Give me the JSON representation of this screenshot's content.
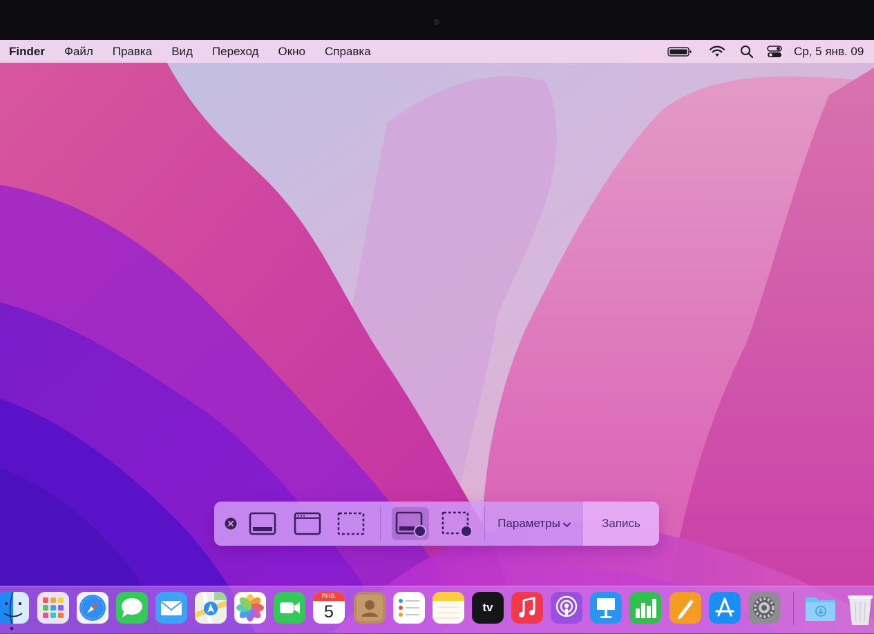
{
  "menubar": {
    "app_name": "Finder",
    "menus": [
      "Файл",
      "Правка",
      "Вид",
      "Переход",
      "Окно",
      "Справка"
    ],
    "status_icons": [
      "battery-icon",
      "wifi-icon",
      "search-icon",
      "control-center-icon"
    ],
    "clock": "Ср, 5 янв. 09"
  },
  "screenshot_toolbar": {
    "buttons": [
      {
        "name": "close",
        "icon": "close-icon"
      },
      {
        "name": "capture-entire-screen",
        "icon": "screen-icon"
      },
      {
        "name": "capture-window",
        "icon": "window-icon"
      },
      {
        "name": "capture-selection",
        "icon": "selection-icon"
      },
      {
        "name": "record-entire-screen",
        "icon": "screen-record-icon",
        "selected": true
      },
      {
        "name": "record-selection",
        "icon": "selection-record-icon"
      }
    ],
    "options_label": "Параметры",
    "record_label": "Запись"
  },
  "dock": {
    "apps": [
      {
        "name": "finder",
        "icon": "finder-icon",
        "running": true
      },
      {
        "name": "launchpad",
        "icon": "launchpad-icon"
      },
      {
        "name": "safari",
        "icon": "safari-icon"
      },
      {
        "name": "messages",
        "icon": "messages-icon"
      },
      {
        "name": "mail",
        "icon": "mail-icon"
      },
      {
        "name": "maps",
        "icon": "maps-icon"
      },
      {
        "name": "photos",
        "icon": "photos-icon"
      },
      {
        "name": "facetime",
        "icon": "facetime-icon"
      },
      {
        "name": "calendar",
        "icon": "calendar-icon"
      },
      {
        "name": "contacts",
        "icon": "contacts-icon"
      },
      {
        "name": "reminders",
        "icon": "reminders-icon"
      },
      {
        "name": "notes",
        "icon": "notes-icon"
      },
      {
        "name": "apple-tv",
        "icon": "apple-tv-icon"
      },
      {
        "name": "music",
        "icon": "music-icon"
      },
      {
        "name": "podcasts",
        "icon": "podcasts-icon"
      },
      {
        "name": "keynote",
        "icon": "keynote-icon"
      },
      {
        "name": "numbers",
        "icon": "numbers-icon"
      },
      {
        "name": "pages",
        "icon": "pages-icon"
      },
      {
        "name": "app-store",
        "icon": "app-store-icon"
      },
      {
        "name": "system-preferences",
        "icon": "gear-icon"
      }
    ],
    "calendar": {
      "month": "ЯНВ.",
      "day": "5"
    },
    "tv_label": "tv",
    "stacks": [
      {
        "name": "downloads",
        "icon": "downloads-folder-icon"
      },
      {
        "name": "trash",
        "icon": "trash-icon"
      }
    ]
  }
}
